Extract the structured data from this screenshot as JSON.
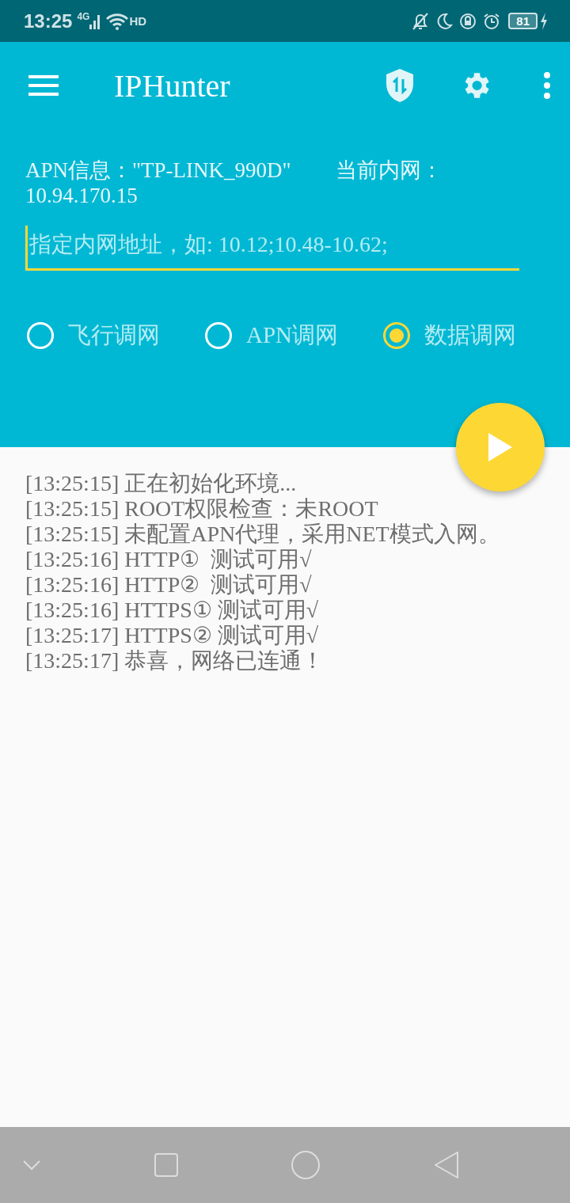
{
  "status_bar": {
    "time": "13:25",
    "network": "4G",
    "call_badge": "HD",
    "battery": "81"
  },
  "app_bar": {
    "title": "IPHunter"
  },
  "info": {
    "apn": "APN信息：\"TP-LINK_990D\"",
    "intranet_label": "当前内网：",
    "intranet": "10.94.170.15"
  },
  "address_field": {
    "placeholder": "指定内网地址，如: 10.12;10.48-10.62;"
  },
  "modes": [
    {
      "label": "飞行调网",
      "selected": false
    },
    {
      "label": "APN调网",
      "selected": false
    },
    {
      "label": "数据调网",
      "selected": true
    }
  ],
  "log": [
    "[13:25:15] 正在初始化环境...",
    "[13:25:15] ROOT权限检查：未ROOT",
    "[13:25:15] 未配置APN代理，采用NET模式入网。",
    "[13:25:16] HTTP①  测试可用√",
    "[13:25:16] HTTP②  测试可用√",
    "[13:25:16] HTTPS① 测试可用√",
    "[13:25:17] HTTPS② 测试可用√",
    "[13:25:17] 恭喜，网络已连通！"
  ]
}
